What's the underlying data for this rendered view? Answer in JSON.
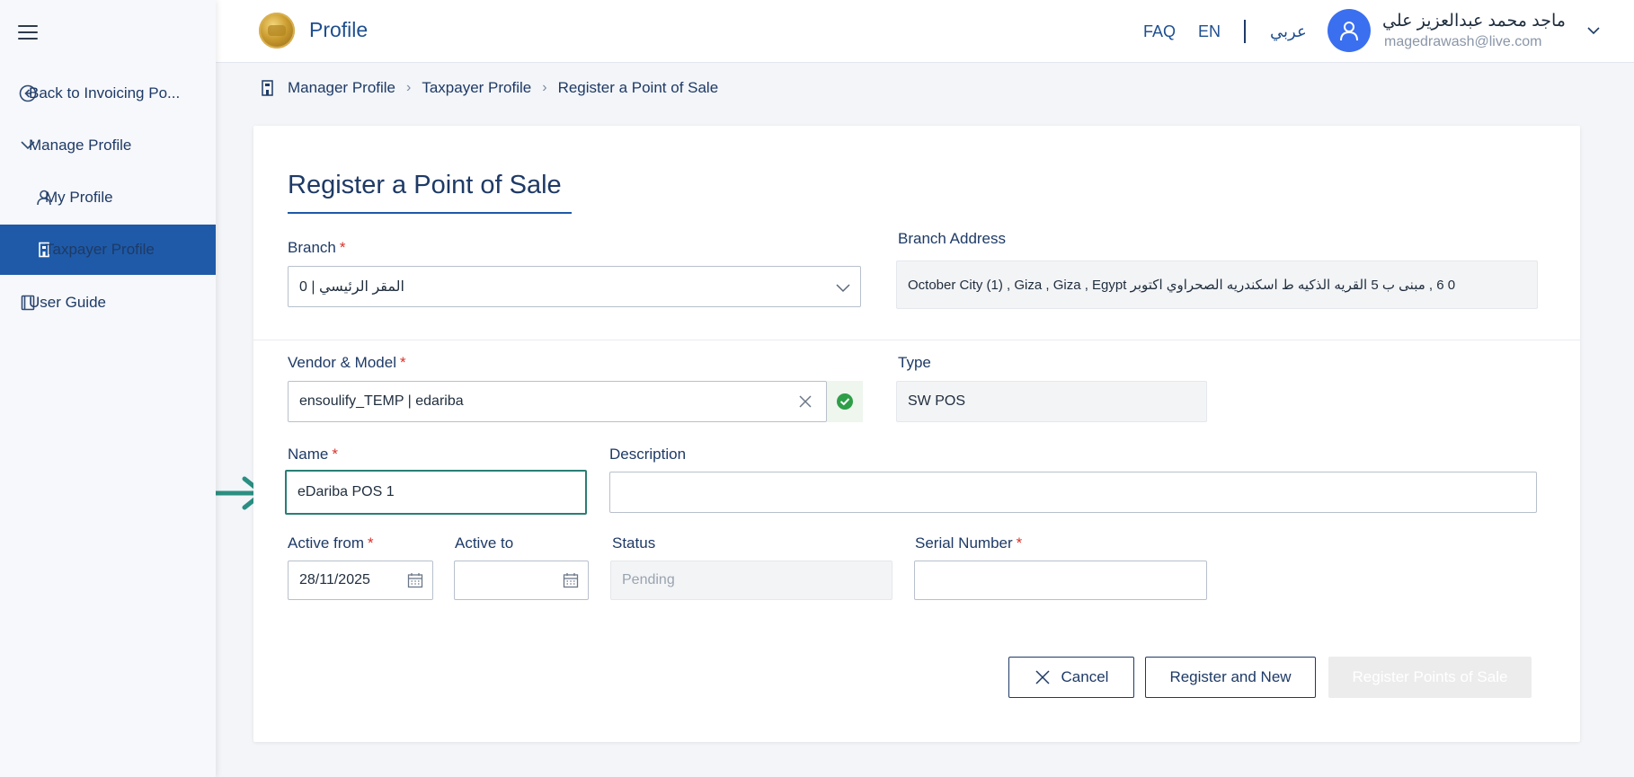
{
  "sidebar": {
    "items": [
      {
        "label": "Back to Invoicing Po...",
        "icon": "back-circle-icon"
      },
      {
        "label": "Manage Profile",
        "icon": "chevron-down-icon"
      },
      {
        "label": "My Profile",
        "icon": "user-icon"
      },
      {
        "label": "Taxpayer Profile",
        "icon": "building-icon",
        "active": true
      },
      {
        "label": "User Guide",
        "icon": "book-icon"
      }
    ]
  },
  "header": {
    "title": "Profile",
    "faq": "FAQ",
    "lang_en": "EN",
    "lang_ar": "عربي",
    "user_name": "ماجد محمد عبدالعزيز علي",
    "user_email": "magedrawash@live.com"
  },
  "breadcrumb": {
    "items": [
      "Manager Profile",
      "Taxpayer Profile",
      "Register a Point of Sale"
    ]
  },
  "form": {
    "title": "Register a Point of Sale",
    "branch": {
      "label": "Branch",
      "value": "المقر الرئيسي | 0"
    },
    "branch_address": {
      "label": "Branch Address",
      "value": "0  6 , مبنى ب 5 القريه الذكيه ط اسكندريه الصحراوي اكتوبر October City (1) , Giza , Giza , Egypt"
    },
    "vendor_model": {
      "label": "Vendor & Model",
      "value": "ensoulify_TEMP | edariba"
    },
    "type": {
      "label": "Type",
      "value": "SW POS"
    },
    "name": {
      "label": "Name",
      "value": "eDariba POS 1"
    },
    "description": {
      "label": "Description",
      "value": ""
    },
    "active_from": {
      "label": "Active from",
      "value": "28/11/2025"
    },
    "active_to": {
      "label": "Active to",
      "value": ""
    },
    "status": {
      "label": "Status",
      "value": "Pending"
    },
    "serial_number": {
      "label": "Serial Number",
      "value": ""
    }
  },
  "buttons": {
    "cancel": "Cancel",
    "register_new": "Register and New",
    "register_pos": "Register Points of Sale"
  },
  "colors": {
    "primary": "#1e5aa8",
    "navy": "#1e3a66",
    "focus": "#2a7e75",
    "required": "#d9322b",
    "success": "#2e9e48"
  }
}
